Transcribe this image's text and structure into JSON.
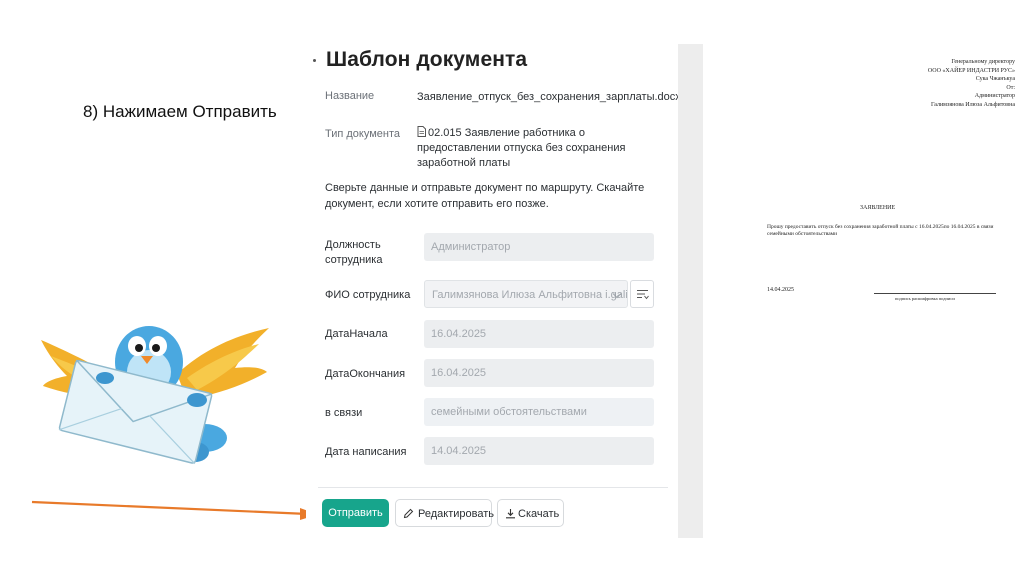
{
  "step_caption": "8) Нажимаем Отправить",
  "panel": {
    "title": "Шаблон документа",
    "name_label": "Название",
    "name_value": "Заявление_отпуск_без_сохранения_зарплаты.docx",
    "type_label": "Тип документа",
    "type_value": "02.015 Заявление работника о предоставлении отпуска без сохранения заработной платы",
    "info": "Сверьте данные и отправьте документ по маршруту. Скачайте документ, если хотите отправить его позже."
  },
  "fields": [
    {
      "label": "Должность сотрудника",
      "value": "Администратор"
    },
    {
      "label": "ФИО сотрудника",
      "value": "Галимзянова Илюза Альфитовна i.galimz"
    },
    {
      "label": "ДатаНачала",
      "value": "16.04.2025"
    },
    {
      "label": "ДатаОкончания",
      "value": "16.04.2025"
    },
    {
      "label": "в связи",
      "value": "семейными обстоятельствами"
    },
    {
      "label": "Дата написания",
      "value": "14.04.2025"
    }
  ],
  "buttons": {
    "send": "Отправить",
    "edit": "Редактировать",
    "download": "Скачать"
  },
  "preview": {
    "header": [
      "Генеральному директору",
      "ООО «ХАЙЕР ИНДАСТРИ РУС»",
      "Сука Чжанъкуа",
      "От:",
      "Администратор",
      "Галимзянова Илюза Альфитовна"
    ],
    "heading": "ЗАЯВЛЕНИЕ",
    "body": "Прошу предоставить отпуск без сохранения заработной платы с 16.04.2025по 16.04.2025 в связи семейными обстоятельствами",
    "date": "14.04.2025",
    "signature_caption": "подпись     расшифровка подписи"
  },
  "colors": {
    "send_button": "#17a58c",
    "arrow": "#e87a2a",
    "bird_blue": "#4aa8e0",
    "bird_wing": "#f2b02a"
  },
  "icons": [
    "document-icon",
    "list-filter-icon",
    "chevron-down-icon",
    "pencil-icon",
    "download-icon"
  ]
}
